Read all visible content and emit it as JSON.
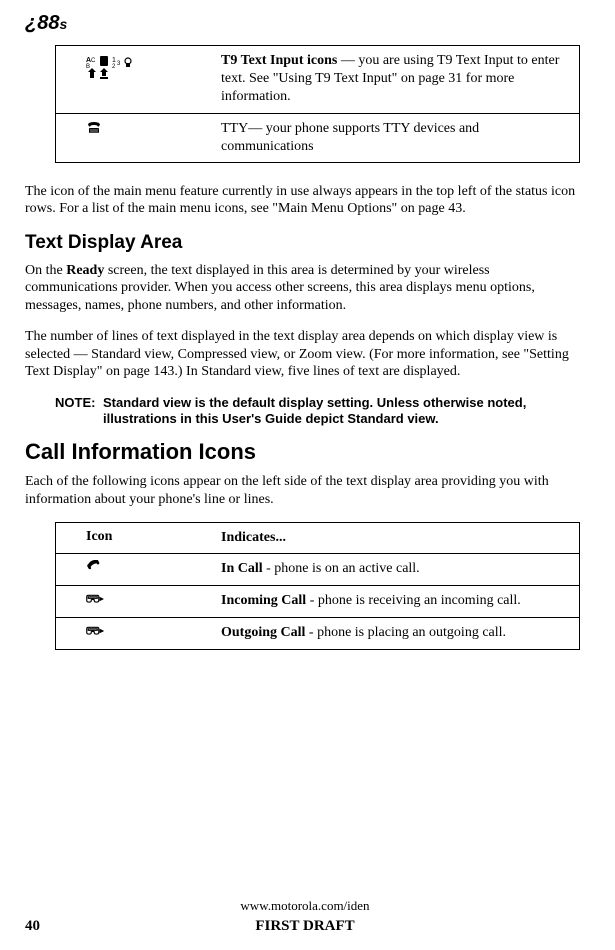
{
  "model": "¿88",
  "model_suffix": "s",
  "icon_table": [
    {
      "icon_svg": "t9",
      "desc_bold": "T9 Text Input icons",
      "desc_rest": " — you are using T9 Text Input to enter text. See \"Using T9 Text Input\" on page 31 for more information."
    },
    {
      "icon_svg": "tty",
      "desc_bold": "",
      "desc_rest": "TTY— your phone supports TTY devices and communications"
    }
  ],
  "para1": "The icon of the main menu feature currently in use always appears in the top left of the status icon rows. For a list of the main menu icons, see \"Main Menu Options\" on page 43.",
  "heading1": "Text Display Area",
  "para2a": "On the ",
  "para2b": "Ready",
  "para2c": " screen, the text displayed in this area is determined by your wireless communications provider. When you access other screens, this area displays menu options, messages, names, phone numbers, and other information.",
  "para3": "The number of lines of text displayed in the text display area depends on which display view is selected — Standard view, Compressed view, or Zoom view. (For more information, see \"Setting Text Display\" on page 143.) In Standard view, five lines of text are displayed.",
  "note_label": "NOTE:",
  "note_text": "Standard view is the default display setting. Unless otherwise noted, illustrations in this User's Guide depict Standard view.",
  "heading2": "Call Information Icons",
  "para4": "Each of the following icons appear on the left side of the text display area providing you with information about your phone's line or lines.",
  "call_table": {
    "header_icon": "Icon",
    "header_desc": "Indicates...",
    "rows": [
      {
        "icon_type": "incall",
        "desc_bold": "In Call",
        "desc_rest": " - phone is on an active call."
      },
      {
        "icon_type": "incoming",
        "desc_bold": "Incoming Call",
        "desc_rest": " - phone is receiving an incoming call."
      },
      {
        "icon_type": "outgoing",
        "desc_bold": "Outgoing Call",
        "desc_rest": " - phone is placing an outgoing call."
      }
    ]
  },
  "footer_url": "www.motorola.com/iden",
  "footer_page": "40",
  "footer_draft": "FIRST DRAFT"
}
